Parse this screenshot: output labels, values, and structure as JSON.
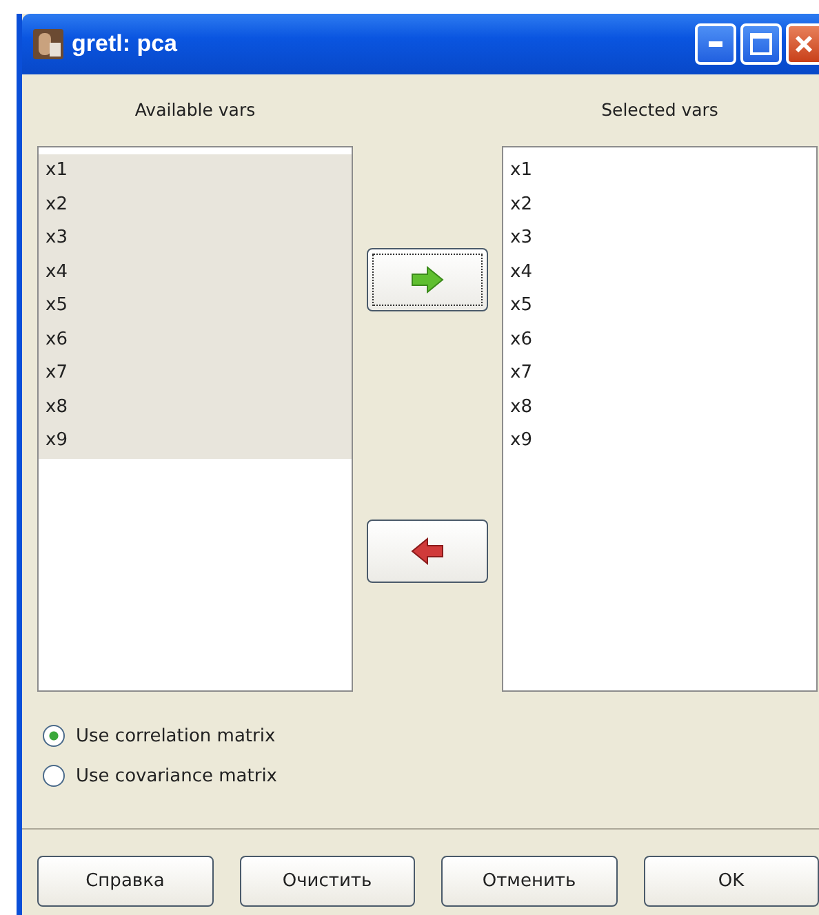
{
  "window": {
    "title": "gretl: pca"
  },
  "available": {
    "label": "Available vars",
    "items": [
      {
        "label": "x1",
        "selected": true
      },
      {
        "label": "x2",
        "selected": true
      },
      {
        "label": "x3",
        "selected": true
      },
      {
        "label": "x4",
        "selected": true
      },
      {
        "label": "x5",
        "selected": true
      },
      {
        "label": "x6",
        "selected": true
      },
      {
        "label": "x7",
        "selected": true
      },
      {
        "label": "x8",
        "selected": true
      },
      {
        "label": "x9",
        "selected": true
      }
    ]
  },
  "selected_vars": {
    "label": "Selected vars",
    "items": [
      {
        "label": "x1",
        "selected": false
      },
      {
        "label": "x2",
        "selected": false
      },
      {
        "label": "x3",
        "selected": false
      },
      {
        "label": "x4",
        "selected": false
      },
      {
        "label": "x5",
        "selected": false
      },
      {
        "label": "x6",
        "selected": false
      },
      {
        "label": "x7",
        "selected": false
      },
      {
        "label": "x8",
        "selected": false
      },
      {
        "label": "x9",
        "selected": false
      }
    ]
  },
  "options": [
    {
      "label": "Use correlation matrix",
      "selected": true
    },
    {
      "label": "Use covariance matrix",
      "selected": false
    }
  ],
  "buttons": [
    "Справка",
    "Очистить",
    "Отменить",
    "OK"
  ]
}
